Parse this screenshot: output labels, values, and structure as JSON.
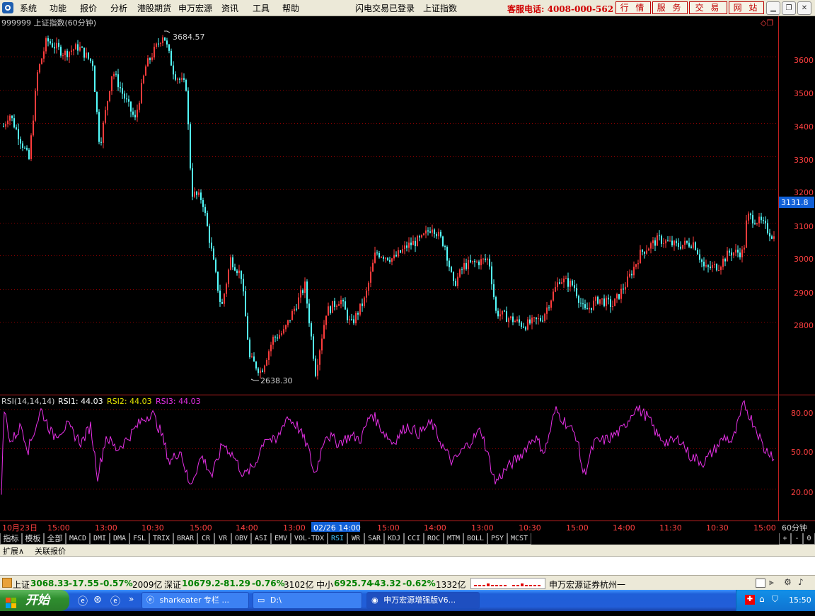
{
  "menu": {
    "items": [
      "系统",
      "功能",
      "报价",
      "分析",
      "港股期货",
      "申万宏源",
      "资讯",
      "工具",
      "帮助"
    ],
    "status_login": "闪电交易已登录",
    "status_index": "上证指数",
    "phone": "客服电话: 4008-000-562",
    "right_buttons": [
      "行 情",
      "服 务",
      "交 易",
      "网 站"
    ]
  },
  "colors": {
    "up": "#ff3c3c",
    "down": "#54ffff",
    "rsi": "#e830e8",
    "grid": "#8b0000",
    "axis": "#ff4040",
    "accent_blue": "#1060d8"
  },
  "main_panel": {
    "title": "999999 上证指数(60分钟)",
    "high_label": "3684.57",
    "low_label": "2638.30",
    "price_tag": "3131.8",
    "y_labels": [
      "3600",
      "3500",
      "3400",
      "3300",
      "3200",
      "3100",
      "3000",
      "2900",
      "2800"
    ]
  },
  "rsi_panel": {
    "name": "RSI(14,14,14)",
    "rsi1": "RSI1: 44.03",
    "rsi2": "RSI2: 44.03",
    "rsi3": "RSI3: 44.03",
    "y_labels": [
      "80.00",
      "50.00",
      "20.00"
    ]
  },
  "time_axis": {
    "labels": [
      "10月23日",
      "15:00",
      "13:00",
      "10:30",
      "15:00",
      "14:00",
      "13:00",
      "15:00",
      "14:00",
      "13:00",
      "10:30",
      "15:00",
      "14:00",
      "11:30",
      "10:30",
      "15:00"
    ],
    "cursor_label": "02/26 14:00",
    "period": "60分钟"
  },
  "tabs": {
    "cn": [
      "指标",
      "模板",
      "全部"
    ],
    "items": [
      "MACD",
      "DMI",
      "DMA",
      "FSL",
      "TRIX",
      "BRAR",
      "CR",
      "VR",
      "OBV",
      "ASI",
      "EMV",
      "VOL-TDX",
      "RSI",
      "WR",
      "SAR",
      "KDJ",
      "CCI",
      "ROC",
      "MTM",
      "BOLL",
      "PSY",
      "MCST"
    ],
    "selected": "RSI",
    "right": [
      "+",
      "-",
      "0"
    ]
  },
  "expand_bar": {
    "items": [
      "扩展∧",
      "关联报价"
    ]
  },
  "ticker": {
    "sh_label": "上证",
    "sh_value": "3068.33",
    "sh_change": "-17.55",
    "sh_pct": "-0.57%",
    "sh_amount": "2009亿",
    "sz_label": "深证",
    "sz_value": "10679.2",
    "sz_change": "-81.29",
    "sz_pct": "-0.76%",
    "sz_amount": "3102亿",
    "zx_label": "中小",
    "zx_value": "6925.74",
    "zx_change": "-43.32",
    "zx_pct": "-0.62%",
    "zx_amount": "1332亿",
    "broker": "申万宏源证券杭州一"
  },
  "taskbar": {
    "start": "开始",
    "windows": [
      "sharkeater 专栏 ...",
      "D:\\",
      "申万宏源增强版V6..."
    ],
    "time": "15:50"
  }
}
